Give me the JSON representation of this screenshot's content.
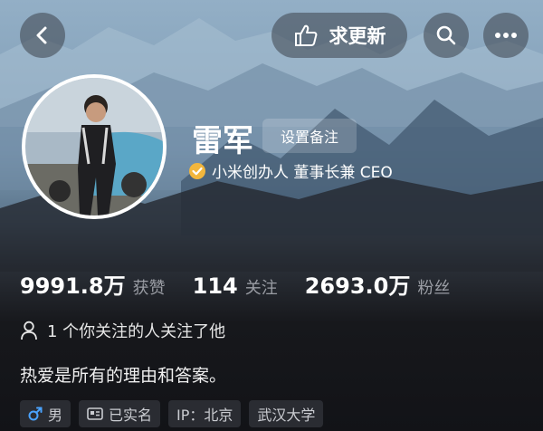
{
  "header": {
    "back_icon": "chevron-left-icon",
    "update_label": "求更新",
    "update_icon": "thumbs-up-hand-icon",
    "search_icon": "search-icon",
    "more_icon": "more-dots-icon"
  },
  "profile": {
    "name": "雷军",
    "remark_button": "设置备注",
    "verified_title": "小米创办人 董事长兼 CEO",
    "verified_icon": "verified-check-icon"
  },
  "stats": [
    {
      "value": "9991.8万",
      "label": "获赞"
    },
    {
      "value": "114",
      "label": "关注"
    },
    {
      "value": "2693.0万",
      "label": "粉丝"
    }
  ],
  "mutual": {
    "icon": "person-icon",
    "text": "1 个你关注的人关注了他"
  },
  "bio": "热爱是所有的理由和答案。",
  "tags": [
    {
      "icon": "male-icon",
      "label": "男"
    },
    {
      "icon": "id-card-icon",
      "label": "已实名"
    },
    {
      "icon": "",
      "label": "IP：北京"
    },
    {
      "icon": "",
      "label": "武汉大学"
    }
  ],
  "colors": {
    "stat_label": "#9a9da4",
    "verified_badge": "#f2b63c",
    "male_icon": "#4aa3ff",
    "tag_bg": "#2a2c32"
  }
}
